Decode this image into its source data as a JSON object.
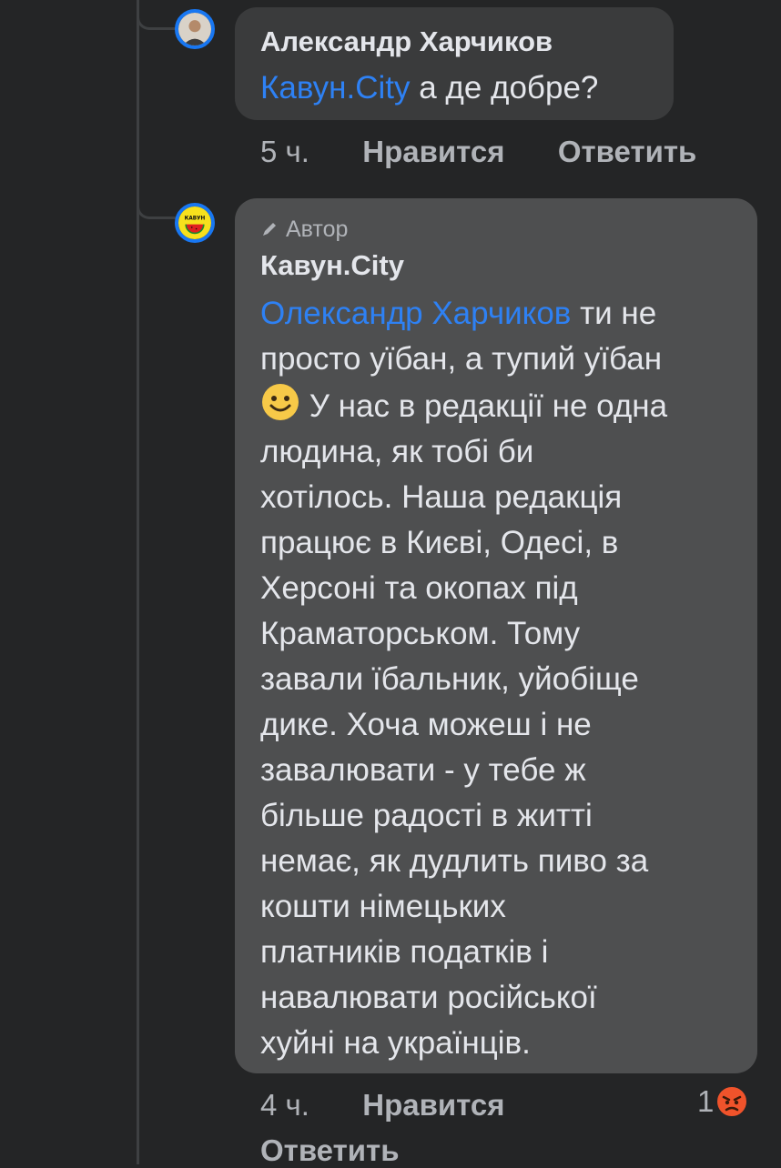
{
  "comments": [
    {
      "author": "Александр Харчиков",
      "mention": "Кавун.City",
      "text": " а де добре?",
      "time": "5 ч.",
      "like_label": "Нравится",
      "reply_label": "Ответить"
    },
    {
      "badge": "Автор",
      "author": "Кавун.City",
      "mention": "Олександр Харчиков",
      "text_line1": " ти не",
      "text_line2": "просто уїбан, а тупий уїбан",
      "text_line3": " У нас в редакції не одна",
      "text_rest": [
        "людина, як тобі би",
        "хотілось. Наша редакція",
        "працює в Києві, Одесі, в",
        "Херсоні та окопах під",
        "Краматорськом. Тому",
        "завали їбальник, уйобіще",
        "дике. Хоча можеш і не",
        "завалювати - у тебе ж",
        "більше радості в житті",
        "немає, як дудлить пиво за",
        "кошти німецьких",
        "платників податків і",
        "навалювати російської",
        "хуйні на українців."
      ],
      "time": "4 ч.",
      "like_label": "Нравится",
      "reply_label": "Ответить",
      "reaction_count": "1",
      "reaction_icon": "angry-emoji-icon",
      "avatar_logo_text": "КАВУН"
    }
  ],
  "colors": {
    "background": "#242526",
    "bubble": "#3a3b3c",
    "author_bubble": "#4e4f50",
    "mention": "#2e81f4",
    "avatar_ring": "#1877f2"
  }
}
